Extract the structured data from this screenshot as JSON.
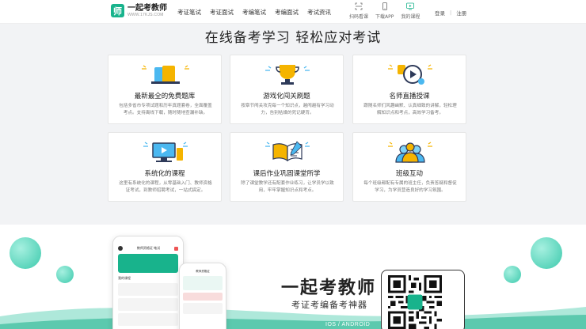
{
  "header": {
    "logo_mark": "师",
    "logo_name": "一起考教师",
    "logo_url": "WWW.17KJS.COM",
    "nav": [
      "考证笔试",
      "考证面试",
      "考编笔试",
      "考编面试",
      "考试资讯"
    ],
    "tools": [
      {
        "label": "扫码看课",
        "icon": "scan-icon"
      },
      {
        "label": "下载APP",
        "icon": "phone-icon"
      },
      {
        "label": "我的课程",
        "icon": "play-screen-icon"
      }
    ],
    "login": "登录",
    "separator": "|",
    "register": "注册"
  },
  "section": {
    "title": "在线备考学习 轻松应对考试",
    "cards": [
      {
        "title": "最新最全的免费题库",
        "desc": "包括多省市专项试题和历年真题套卷，全面覆盖考点。支持离线下载，随时随地查漏补缺。",
        "icon": "books-icon"
      },
      {
        "title": "游戏化闯关刷题",
        "desc": "按章节闯关攻克每一个知识点，越闯越有学习动力，告别枯燥的死记硬背。",
        "icon": "trophy-icon"
      },
      {
        "title": "名师直播授课",
        "desc": "跟随名师们风趣幽默、认真细致的讲解，轻松理解知识点和考点，高效学习备考。",
        "icon": "live-play-icon"
      },
      {
        "title": "系统化的课程",
        "desc": "这里有系统化的课程，从零基础入门、教师资格证考试，到教师招聘考试，一站式搞定。",
        "icon": "monitor-icon"
      },
      {
        "title": "课后作业巩固课堂所学",
        "desc": "除了课堂教学还有配套作业练习，让学员学以致用，牢牢掌握知识点和考点。",
        "icon": "open-book-icon"
      },
      {
        "title": "班级互动",
        "desc": "每个班级都配有专属的班主任，负责答疑和督促学习，为学员营造良好的学习氛围。",
        "icon": "group-icon"
      }
    ]
  },
  "banner": {
    "slogan_main": "一起考教师",
    "slogan_sub": "考证考编备考神器",
    "platform": "IOS / ANDROID",
    "app_header": "教师资格证·笔试",
    "app_header2": "教师资格证",
    "app_section": "我的课程",
    "colors": {
      "brand": "#18b38c",
      "bubble": "#3cc9ac",
      "wave": "#aee8da"
    }
  }
}
